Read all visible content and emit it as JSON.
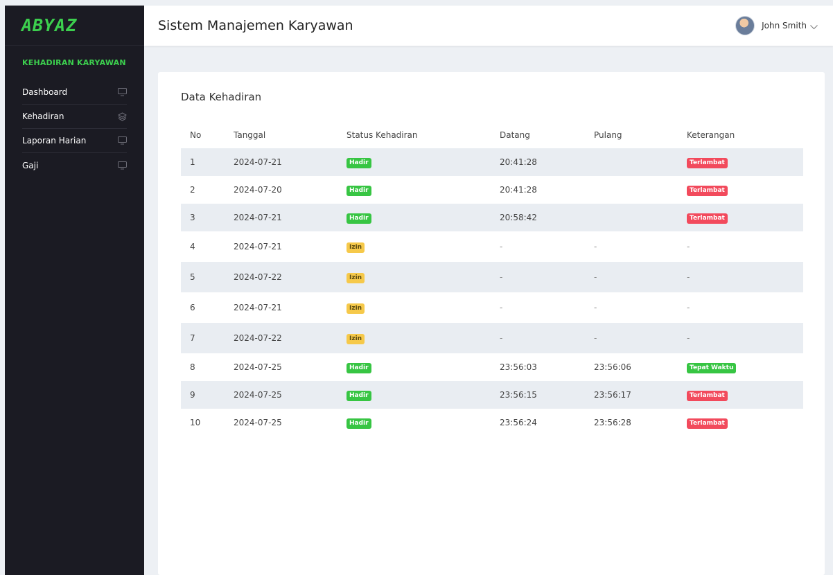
{
  "brand": {
    "logo_text": "ABYAZ",
    "accent": "#3ccf4e"
  },
  "sidebar": {
    "section_title": "KEHADIRAN KARYAWAN",
    "items": [
      {
        "label": "Dashboard",
        "icon": "monitor-icon"
      },
      {
        "label": "Kehadiran",
        "icon": "layers-icon"
      },
      {
        "label": "Laporan Harian",
        "icon": "monitor-icon"
      },
      {
        "label": "Gaji",
        "icon": "monitor-icon"
      }
    ]
  },
  "header": {
    "title": "Sistem Manajemen Karyawan",
    "user_name": "John Smith"
  },
  "card": {
    "title": "Data Kehadiran",
    "columns": [
      "No",
      "Tanggal",
      "Status Kehadiran",
      "Datang",
      "Pulang",
      "Keterangan"
    ],
    "rows": [
      {
        "no": "1",
        "tanggal": "2024-07-21",
        "status": "Hadir",
        "datang": "20:41:28",
        "pulang": "",
        "keterangan": "Terlambat"
      },
      {
        "no": "2",
        "tanggal": "2024-07-20",
        "status": "Hadir",
        "datang": "20:41:28",
        "pulang": "",
        "keterangan": "Terlambat"
      },
      {
        "no": "3",
        "tanggal": "2024-07-21",
        "status": "Hadir",
        "datang": "20:58:42",
        "pulang": "",
        "keterangan": "Terlambat"
      },
      {
        "no": "4",
        "tanggal": "2024-07-21",
        "status": "Izin",
        "datang": "-",
        "pulang": "-",
        "keterangan": "-"
      },
      {
        "no": "5",
        "tanggal": "2024-07-22",
        "status": "Izin",
        "datang": "-",
        "pulang": "-",
        "keterangan": "-"
      },
      {
        "no": "6",
        "tanggal": "2024-07-21",
        "status": "Izin",
        "datang": "-",
        "pulang": "-",
        "keterangan": "-"
      },
      {
        "no": "7",
        "tanggal": "2024-07-22",
        "status": "Izin",
        "datang": "-",
        "pulang": "-",
        "keterangan": "-"
      },
      {
        "no": "8",
        "tanggal": "2024-07-25",
        "status": "Hadir",
        "datang": "23:56:03",
        "pulang": "23:56:06",
        "keterangan": "Tepat Waktu"
      },
      {
        "no": "9",
        "tanggal": "2024-07-25",
        "status": "Hadir",
        "datang": "23:56:15",
        "pulang": "23:56:17",
        "keterangan": "Terlambat"
      },
      {
        "no": "10",
        "tanggal": "2024-07-25",
        "status": "Hadir",
        "datang": "23:56:24",
        "pulang": "23:56:28",
        "keterangan": "Terlambat"
      }
    ]
  },
  "colors": {
    "hadir": "#37c543",
    "izin": "#f6c94a",
    "terlambat": "#f24a5c",
    "tepat_waktu": "#37c543"
  }
}
